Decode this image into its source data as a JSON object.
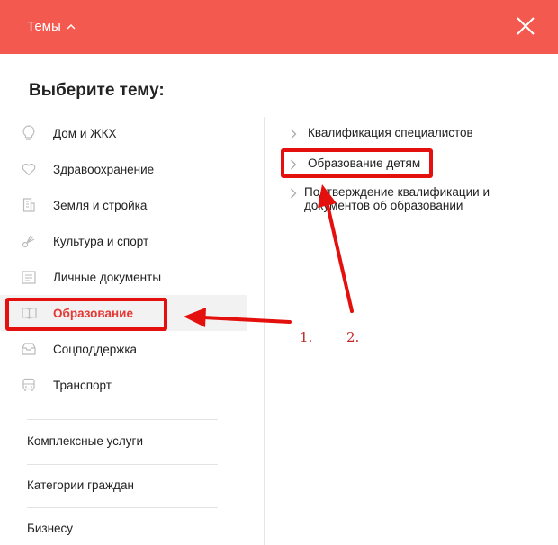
{
  "header": {
    "title": "Темы",
    "title_icon": "chevron-up-icon",
    "close_icon": "close-icon",
    "background": "#f4594f"
  },
  "heading": "Выберите тему:",
  "topics": [
    {
      "label": "Дом и ЖКХ",
      "icon": "lightbulb-icon"
    },
    {
      "label": "Здравоохранение",
      "icon": "heart-icon"
    },
    {
      "label": "Земля и стройка",
      "icon": "building-icon"
    },
    {
      "label": "Культура и спорт",
      "icon": "shuttlecock-icon"
    },
    {
      "label": "Личные документы",
      "icon": "document-icon"
    },
    {
      "label": "Образование",
      "icon": "book-icon",
      "active": true
    },
    {
      "label": "Соцподдержка",
      "icon": "tray-icon"
    },
    {
      "label": "Транспорт",
      "icon": "bus-icon"
    }
  ],
  "extra": [
    {
      "label": "Комплексные услуги"
    },
    {
      "label": "Категории граждан"
    },
    {
      "label": "Бизнесу"
    }
  ],
  "subtopics": [
    {
      "label": "Квалификация специалистов"
    },
    {
      "label": "Образование детям"
    },
    {
      "label": "Подтверждение квалификации и документов об образовании"
    }
  ],
  "annotations": {
    "label_1": "1.",
    "label_2": "2.",
    "color": "#e3100d"
  },
  "colors": {
    "accent": "#f4594f",
    "active_text": "#e53935",
    "highlight": "#e3100d"
  }
}
